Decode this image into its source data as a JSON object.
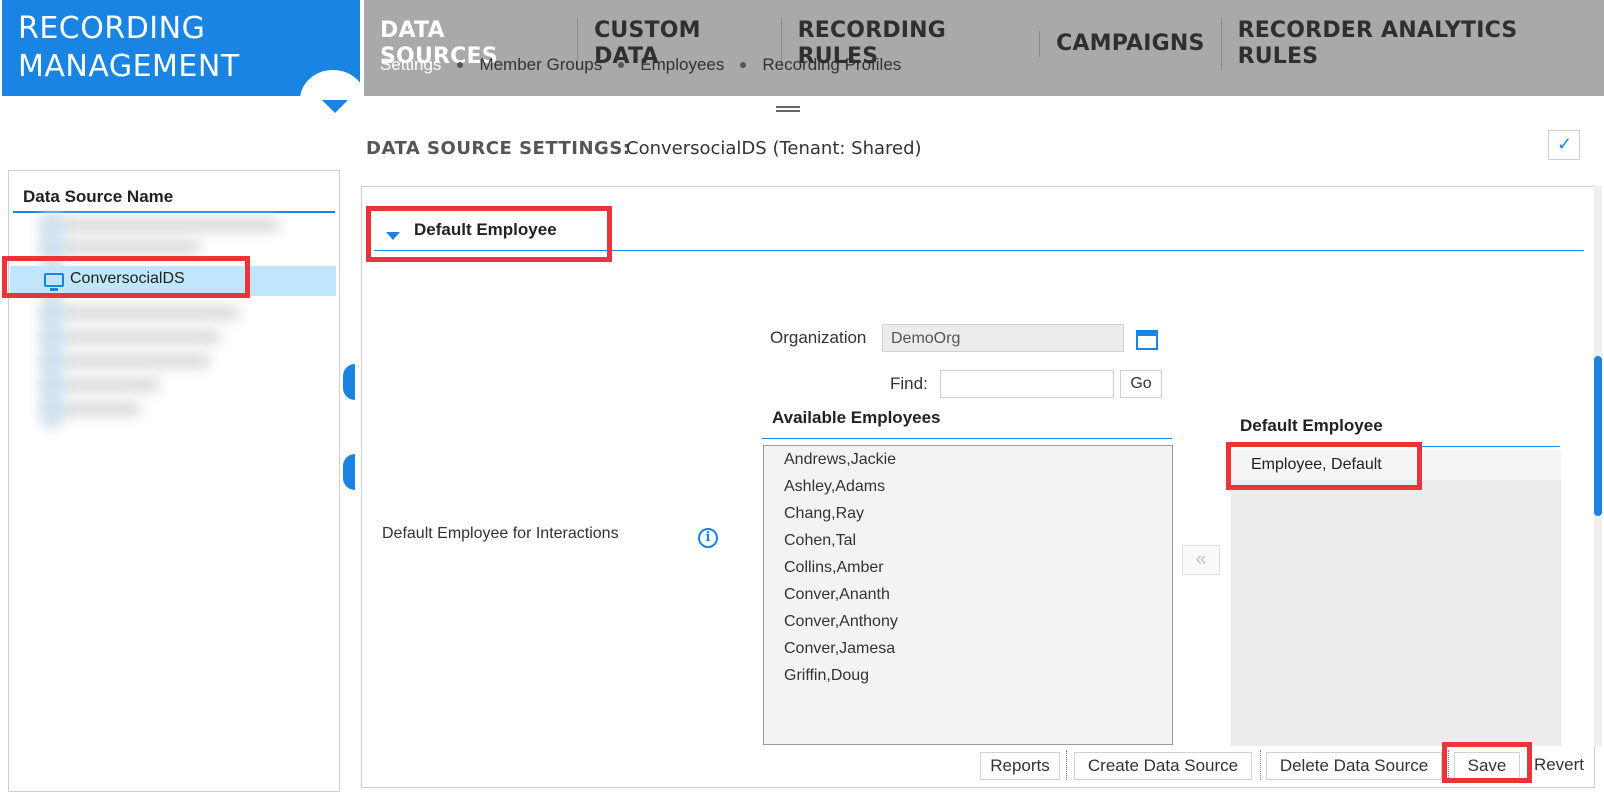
{
  "brand": {
    "line1": "RECORDING",
    "line2": "MANAGEMENT"
  },
  "main_nav": [
    {
      "label": "DATA SOURCES"
    },
    {
      "label": "CUSTOM DATA"
    },
    {
      "label": "RECORDING RULES"
    },
    {
      "label": "CAMPAIGNS"
    },
    {
      "label": "RECORDER ANALYTICS RULES"
    }
  ],
  "sub_nav": [
    {
      "label": "Settings"
    },
    {
      "label": "Member Groups"
    },
    {
      "label": "Employees"
    },
    {
      "label": "Recording Profiles"
    }
  ],
  "left_panel": {
    "header": "Data Source Name",
    "selected_item": "ConversocialDS"
  },
  "settings": {
    "title": "DATA SOURCE SETTINGS:",
    "value": "ConversocialDS (Tenant: Shared)",
    "check_glyph": "✓"
  },
  "section": {
    "title": "Default Employee"
  },
  "form": {
    "row_label": "Default Employee for Interactions",
    "info_glyph": "i",
    "organization_label": "Organization",
    "organization_value": "DemoOrg",
    "find_label": "Find:",
    "find_value": "",
    "go_label": "Go",
    "available_title": "Available Employees",
    "available_employees": [
      "Andrews,Jackie",
      "Ashley,Adams",
      "Chang,Ray",
      "Cohen,Tal",
      "Collins,Amber",
      "Conver,Ananth",
      "Conver,Anthony",
      "Conver,Jamesa",
      "Griffin,Doug"
    ],
    "move_left_glyph": "«",
    "default_title": "Default Employee",
    "default_employees": [
      "Employee, Default"
    ]
  },
  "toolbar": {
    "reports": "Reports",
    "create": "Create Data Source",
    "delete": "Delete Data Source",
    "save": "Save",
    "revert": "Revert"
  },
  "colors": {
    "brand_blue": "#1a84e3",
    "header_gray": "#a9a9a9",
    "highlight_red": "#e8343a",
    "selection": "#bfe6fb"
  }
}
